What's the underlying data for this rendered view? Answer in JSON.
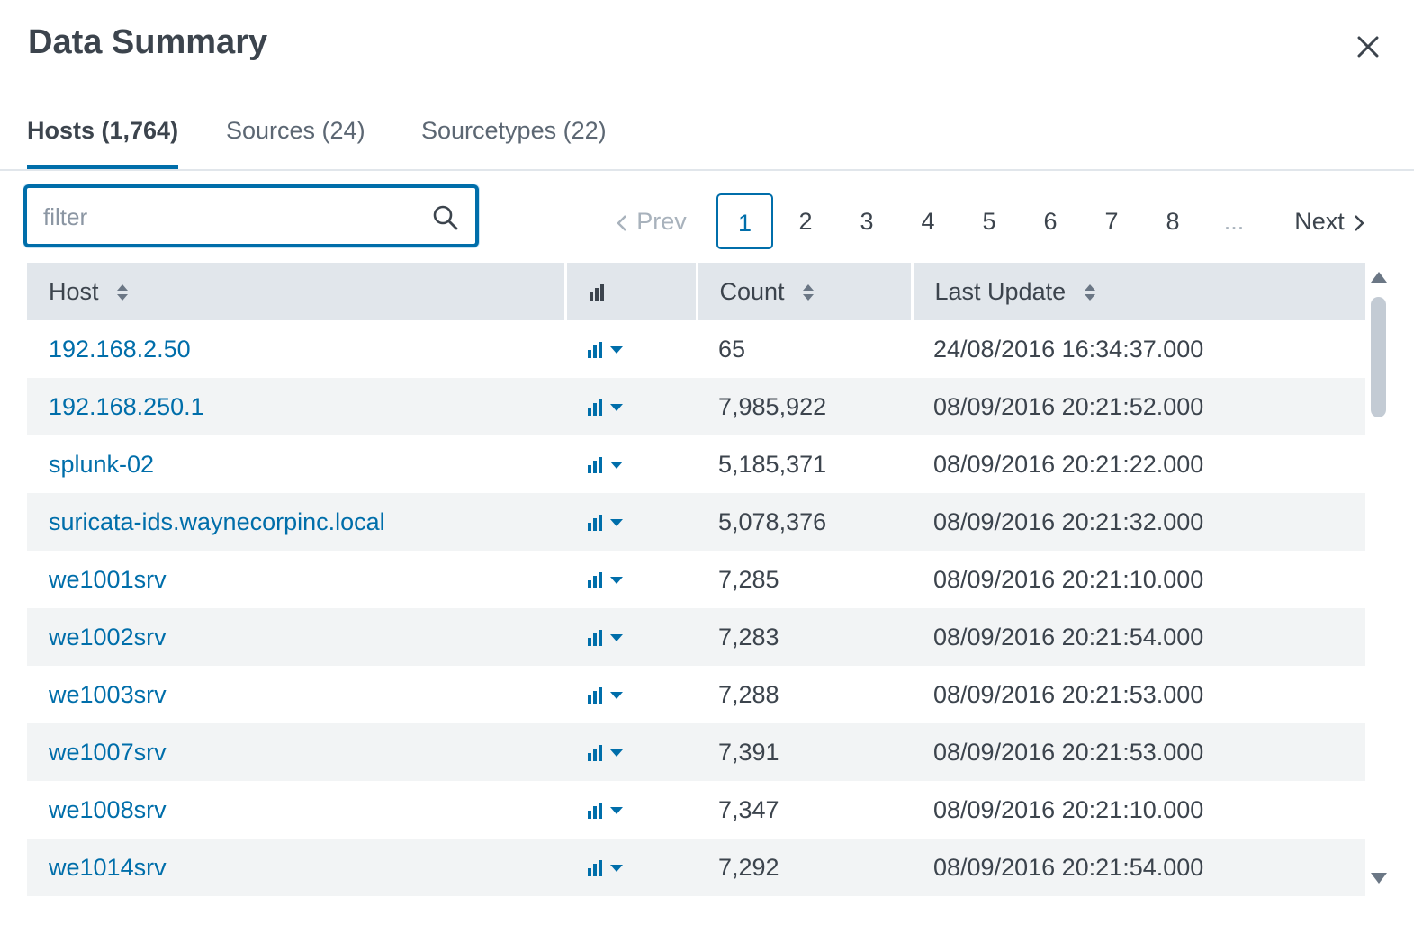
{
  "title": "Data Summary",
  "tabs": [
    {
      "label": "Hosts (1,764)",
      "active": true
    },
    {
      "label": "Sources (24)",
      "active": false
    },
    {
      "label": "Sourcetypes (22)",
      "active": false
    }
  ],
  "filter": {
    "placeholder": "filter",
    "value": ""
  },
  "pagination": {
    "prev": "Prev",
    "next": "Next",
    "pages": [
      "1",
      "2",
      "3",
      "4",
      "5",
      "6",
      "7",
      "8"
    ],
    "ellipsis": "...",
    "current": "1"
  },
  "table": {
    "columns": [
      "Host",
      "",
      "Count",
      "Last Update"
    ],
    "rows": [
      {
        "host": "192.168.2.50",
        "count": "65",
        "last_update": "24/08/2016 16:34:37.000"
      },
      {
        "host": "192.168.250.1",
        "count": "7,985,922",
        "last_update": "08/09/2016 20:21:52.000"
      },
      {
        "host": "splunk-02",
        "count": "5,185,371",
        "last_update": "08/09/2016 20:21:22.000"
      },
      {
        "host": "suricata-ids.waynecorpinc.local",
        "count": "5,078,376",
        "last_update": "08/09/2016 20:21:32.000"
      },
      {
        "host": "we1001srv",
        "count": "7,285",
        "last_update": "08/09/2016 20:21:10.000"
      },
      {
        "host": "we1002srv",
        "count": "7,283",
        "last_update": "08/09/2016 20:21:54.000"
      },
      {
        "host": "we1003srv",
        "count": "7,288",
        "last_update": "08/09/2016 20:21:53.000"
      },
      {
        "host": "we1007srv",
        "count": "7,391",
        "last_update": "08/09/2016 20:21:53.000"
      },
      {
        "host": "we1008srv",
        "count": "7,347",
        "last_update": "08/09/2016 20:21:10.000"
      },
      {
        "host": "we1014srv",
        "count": "7,292",
        "last_update": "08/09/2016 20:21:54.000"
      }
    ]
  },
  "icons": {
    "close": "close-icon",
    "search": "search-icon",
    "sort": "sort-icon",
    "bar_chart": "bar-chart-icon",
    "caret_down": "caret-down-icon",
    "chevron_left": "chevron-left-icon",
    "chevron_right": "chevron-right-icon"
  },
  "colors": {
    "accent": "#006eaa",
    "header_bg": "#e1e6eb",
    "row_alt_bg": "#f2f4f5",
    "text": "#3c444d"
  }
}
